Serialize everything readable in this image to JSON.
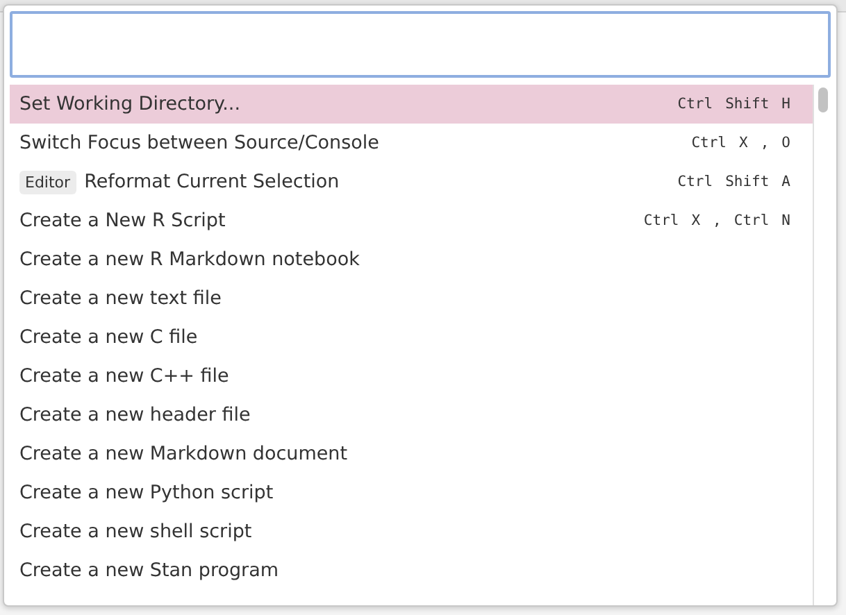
{
  "commands": [
    {
      "label": "Set Working Directory...",
      "selected": true,
      "keys": [
        "Ctrl",
        "Shift",
        "H"
      ]
    },
    {
      "label": "Switch Focus between Source/Console",
      "selected": false,
      "keys": [
        "Ctrl",
        "X",
        ",",
        "O"
      ]
    },
    {
      "label": "Reformat Current Selection",
      "tag": "Editor",
      "selected": false,
      "keys": [
        "Ctrl",
        "Shift",
        "A"
      ]
    },
    {
      "label": "Create a New R Script",
      "selected": false,
      "keys": [
        "Ctrl",
        "X",
        ",",
        "Ctrl",
        "N"
      ]
    },
    {
      "label": "Create a new R Markdown notebook",
      "selected": false
    },
    {
      "label": "Create a new text file",
      "selected": false
    },
    {
      "label": "Create a new C file",
      "selected": false
    },
    {
      "label": "Create a new C++ file",
      "selected": false
    },
    {
      "label": "Create a new header file",
      "selected": false
    },
    {
      "label": "Create a new Markdown document",
      "selected": false
    },
    {
      "label": "Create a new Python script",
      "selected": false
    },
    {
      "label": "Create a new shell script",
      "selected": false
    },
    {
      "label": "Create a new Stan program",
      "selected": false
    }
  ]
}
